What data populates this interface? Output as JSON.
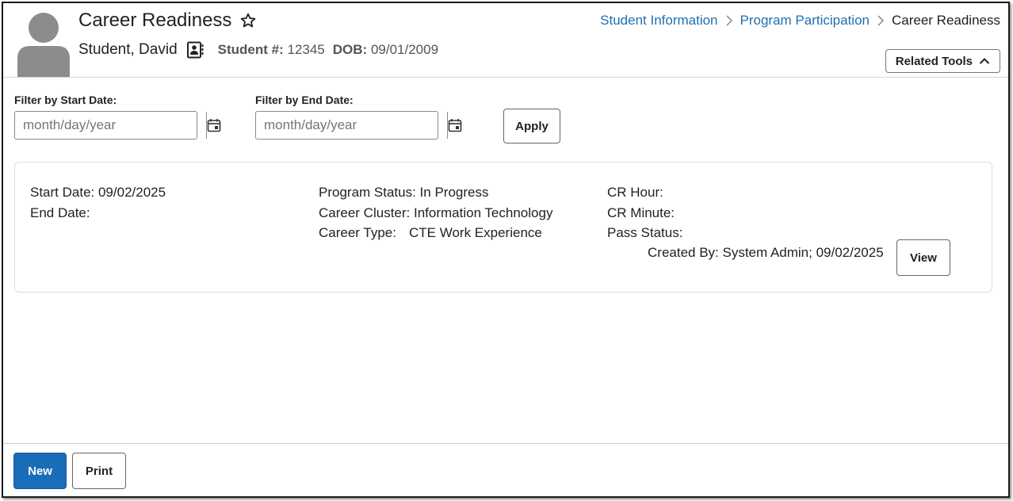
{
  "header": {
    "title": "Career Readiness",
    "student_name": "Student, David",
    "student_number_label": "Student #:",
    "student_number": "12345",
    "dob_label": "DOB:",
    "dob": "09/01/2009"
  },
  "breadcrumb": {
    "items": [
      "Student Information",
      "Program Participation",
      "Career Readiness"
    ]
  },
  "related_tools": {
    "label": "Related Tools"
  },
  "filters": {
    "start_label": "Filter by Start Date:",
    "end_label": "Filter by End Date:",
    "start_placeholder": "month/day/year",
    "end_placeholder": "month/day/year",
    "apply_label": "Apply"
  },
  "record": {
    "start_date": "Start Date: 09/02/2025",
    "end_date": "End Date:",
    "program_status": "Program Status: In Progress",
    "career_cluster": "Career Cluster: Information Technology",
    "career_type_label": "Career Type:",
    "career_type_value": "CTE Work Experience",
    "cr_hour": "CR Hour:",
    "cr_minute": "CR Minute:",
    "pass_status": "Pass Status:",
    "created_by": "Created By: System Admin; 09/02/2025",
    "view_label": "View"
  },
  "footer": {
    "new_label": "New",
    "print_label": "Print"
  },
  "colors": {
    "link": "#1f6fb2",
    "primary": "#1a6db8",
    "avatar": "#8c8c8c"
  }
}
